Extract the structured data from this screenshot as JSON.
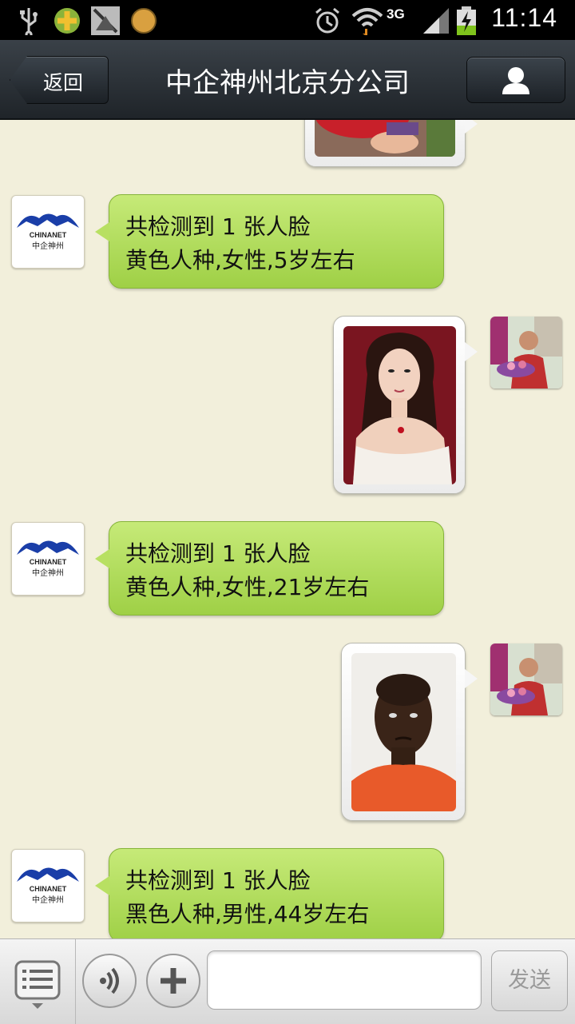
{
  "status_bar": {
    "time": "11:14",
    "network": "3G",
    "icons": [
      "usb-icon",
      "app-icon",
      "no-signal-app-icon",
      "circle-app-icon",
      "alarm-icon",
      "wifi-icon",
      "signal-icon",
      "battery-charging-icon"
    ]
  },
  "header": {
    "back_label": "返回",
    "title": "中企神州北京分公司",
    "profile_icon": "person-icon"
  },
  "brand": {
    "logo_text": "CHINANET",
    "logo_subtext": "中企神州"
  },
  "messages": [
    {
      "from": "bot",
      "line1": "共检测到 1 张人脸",
      "line2": "黄色人种,女性,5岁左右"
    },
    {
      "from": "me",
      "type": "image",
      "subject": "woman-portrait"
    },
    {
      "from": "bot",
      "line1": "共检测到 1 张人脸",
      "line2": "黄色人种,女性,21岁左右"
    },
    {
      "from": "me",
      "type": "image",
      "subject": "man-portrait"
    },
    {
      "from": "bot",
      "line1": "共检测到 1 张人脸",
      "line2": "黑色人种,男性,44岁左右"
    }
  ],
  "bottom_bar": {
    "menu_icon": "list-menu-icon",
    "voice_icon": "voice-icon",
    "plus_icon": "plus-icon",
    "input_value": "",
    "send_label": "发送"
  },
  "colors": {
    "bubble_green": "#b8e062",
    "background": "#f2efdb",
    "header": "#2b3137"
  }
}
